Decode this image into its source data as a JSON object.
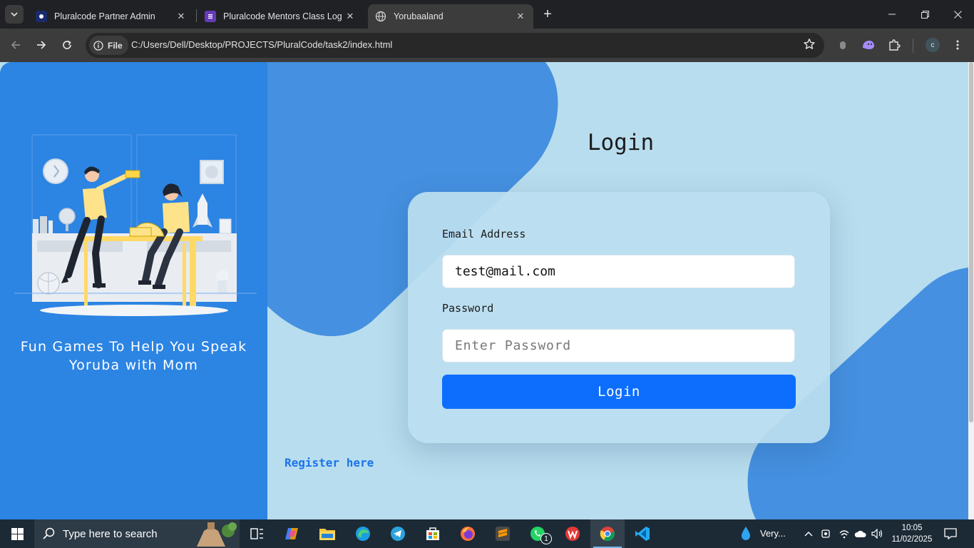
{
  "browser": {
    "tabs": [
      {
        "title": "Pluralcode Partner Admin",
        "active": false
      },
      {
        "title": "Pluralcode Mentors Class Log",
        "active": false
      },
      {
        "title": "Yorubaaland",
        "active": true
      }
    ],
    "site_chip": "File",
    "url": "C:/Users/Dell/Desktop/PROJECTS/PluralCode/task2/index.html",
    "profile_initial": "c"
  },
  "page": {
    "tagline": "Fun Games To Help You Speak Yoruba with Mom",
    "login_heading": "Login",
    "email_label": "Email Address",
    "email_value": "test@mail.com",
    "password_label": "Password",
    "password_placeholder": "Enter Password",
    "login_button": "Login",
    "register_link": "Register here",
    "colors": {
      "panel_blue": "#2c84e3",
      "page_bg": "#b8ddee",
      "button_blue": "#0d6efd",
      "link_blue": "#1c74e8"
    }
  },
  "taskbar": {
    "search_placeholder": "Type here to search",
    "weather": "Very...",
    "time": "10:05",
    "date": "11/02/2025",
    "whatsapp_badge": "1",
    "apps": [
      "task-view-icon",
      "copilot-icon",
      "file-explorer-icon",
      "edge-icon",
      "telegram-icon",
      "store-icon",
      "firefox-icon",
      "sublime-text-icon",
      "whatsapp-icon",
      "wps-office-icon",
      "chrome-icon",
      "vscode-icon"
    ]
  }
}
